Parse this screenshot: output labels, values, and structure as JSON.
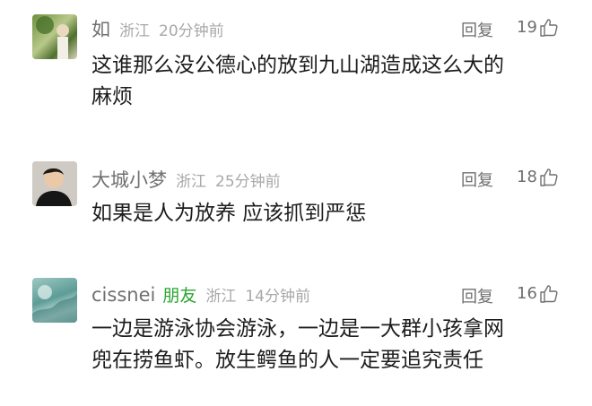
{
  "comments": [
    {
      "name": "如",
      "friend_badge": "",
      "location": "浙江",
      "time": "20分钟前",
      "reply_label": "回复",
      "likes": "19",
      "lines": [
        "这谁那么没公德心的放到九山湖造成这么大的",
        "麻烦"
      ]
    },
    {
      "name": "大城小梦",
      "friend_badge": "",
      "location": "浙江",
      "time": "25分钟前",
      "reply_label": "回复",
      "likes": "18",
      "lines": [
        "如果是人为放养 应该抓到严惩"
      ]
    },
    {
      "name": "cissnei",
      "friend_badge": "朋友",
      "location": "浙江",
      "time": "14分钟前",
      "reply_label": "回复",
      "likes": "16",
      "lines": [
        "一边是游泳协会游泳，一边是一大群小孩拿网",
        "兜在捞鱼虾。放生鳄鱼的人一定要追究责任"
      ]
    }
  ],
  "icons": {
    "like": "thumb-up-outline-icon"
  },
  "colors": {
    "friend_badge": "#2aa52f",
    "meta": "#a8a8a8",
    "text": "#1c1c1c"
  }
}
